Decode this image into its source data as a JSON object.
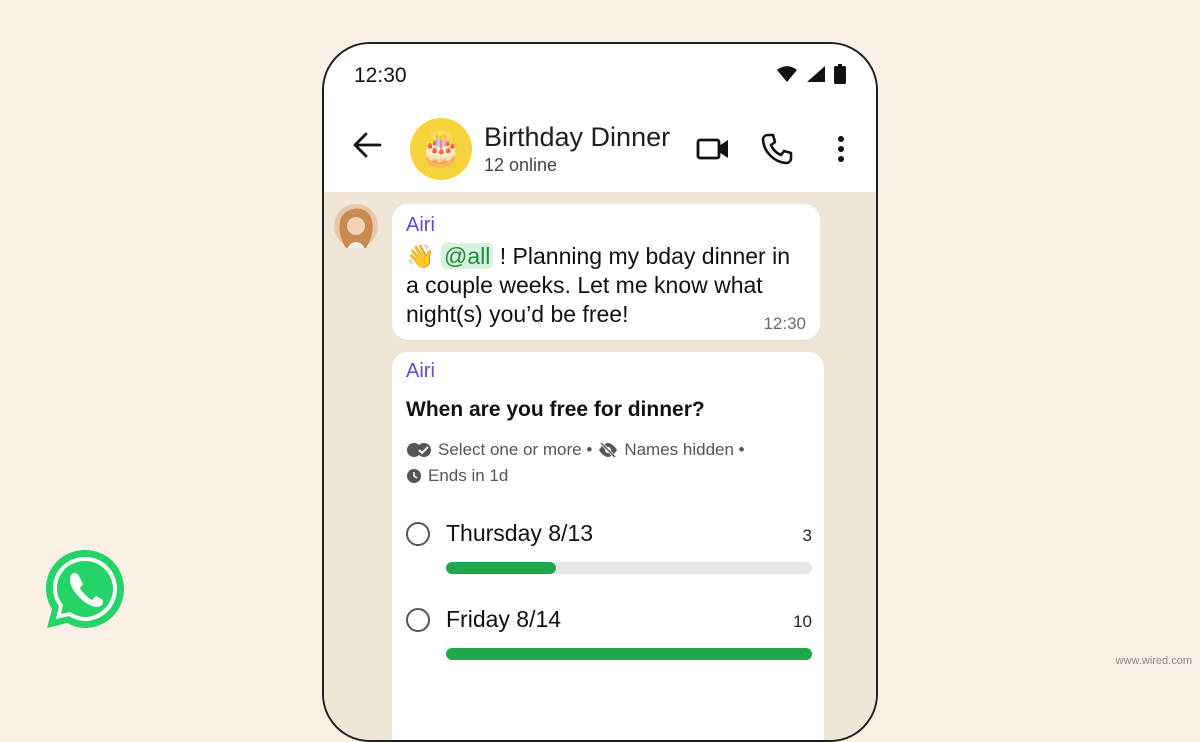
{
  "status_bar": {
    "time": "12:30"
  },
  "header": {
    "group_avatar_emoji": "🎂",
    "title": "Birthday Dinner",
    "subtitle": "12 online"
  },
  "message": {
    "sender": "Airi",
    "wave_emoji": "👋",
    "mention": "@all",
    "text_line1_after_mention": " ! Planning my bday dinner in",
    "text_line2": "a couple weeks. Let me know what",
    "text_line3": "night(s) you’d be free!",
    "time": "12:30"
  },
  "poll": {
    "sender": "Airi",
    "question": "When are you free for dinner?",
    "meta1": "Select one or more •",
    "meta2": "Names hidden •",
    "meta3": "Ends in 1d",
    "options": [
      {
        "label": "Thursday 8/13",
        "count": "3",
        "fraction": 0.3
      },
      {
        "label": "Friday 8/14",
        "count": "10",
        "fraction": 1.0
      }
    ]
  },
  "colors": {
    "accent_green": "#1fa84b",
    "sender_purple": "#5b4fc7",
    "whatsapp_green": "#25d366"
  },
  "credit": "www.wired.com"
}
